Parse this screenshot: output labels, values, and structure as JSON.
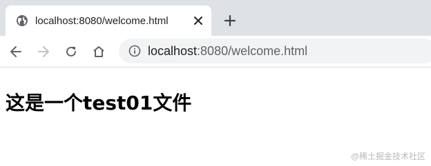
{
  "tab": {
    "title": "localhost:8080/welcome.html",
    "favicon": "globe-icon"
  },
  "toolbar": {
    "url_host": "localhost",
    "url_rest": ":8080/welcome.html",
    "icons": [
      "back-arrow-icon",
      "forward-arrow-icon",
      "reload-icon",
      "home-icon",
      "info-icon"
    ]
  },
  "page": {
    "heading": "这是一个test01文件"
  },
  "watermark": "@稀土掘金技术社区",
  "colors": {
    "tabstrip_bg": "#dee1e6",
    "omnibox_bg": "#f1f3f4",
    "icon": "#5f6368",
    "icon_disabled": "#bdc1c6"
  }
}
